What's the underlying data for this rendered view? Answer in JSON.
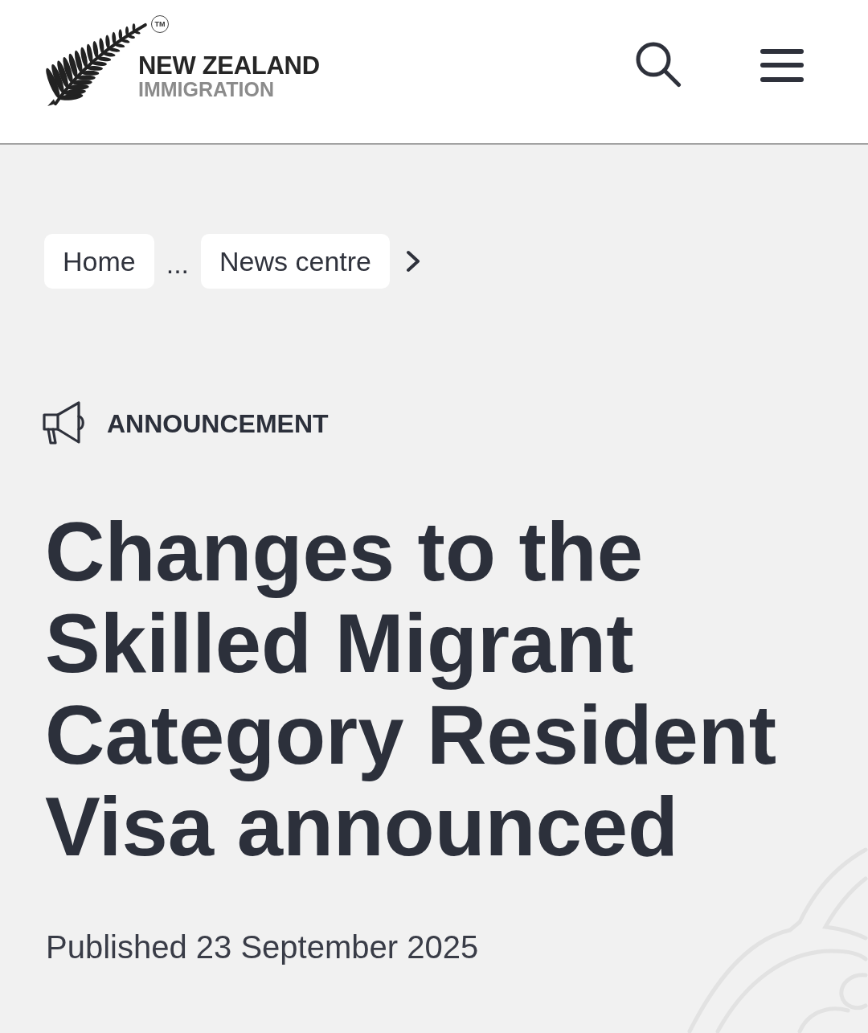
{
  "header": {
    "logo": {
      "name": "NEW ZEALAND",
      "subtitle": "IMMIGRATION",
      "trademark": "TM"
    }
  },
  "breadcrumb": {
    "items": [
      {
        "label": "Home",
        "kind": "link"
      },
      {
        "label": "...",
        "kind": "ellipsis"
      },
      {
        "label": "News centre",
        "kind": "link"
      }
    ]
  },
  "article": {
    "category": "ANNOUNCEMENT",
    "title": "Changes to the Skilled Migrant Category Resident Visa announced",
    "published": "Published 23 September 2025"
  }
}
